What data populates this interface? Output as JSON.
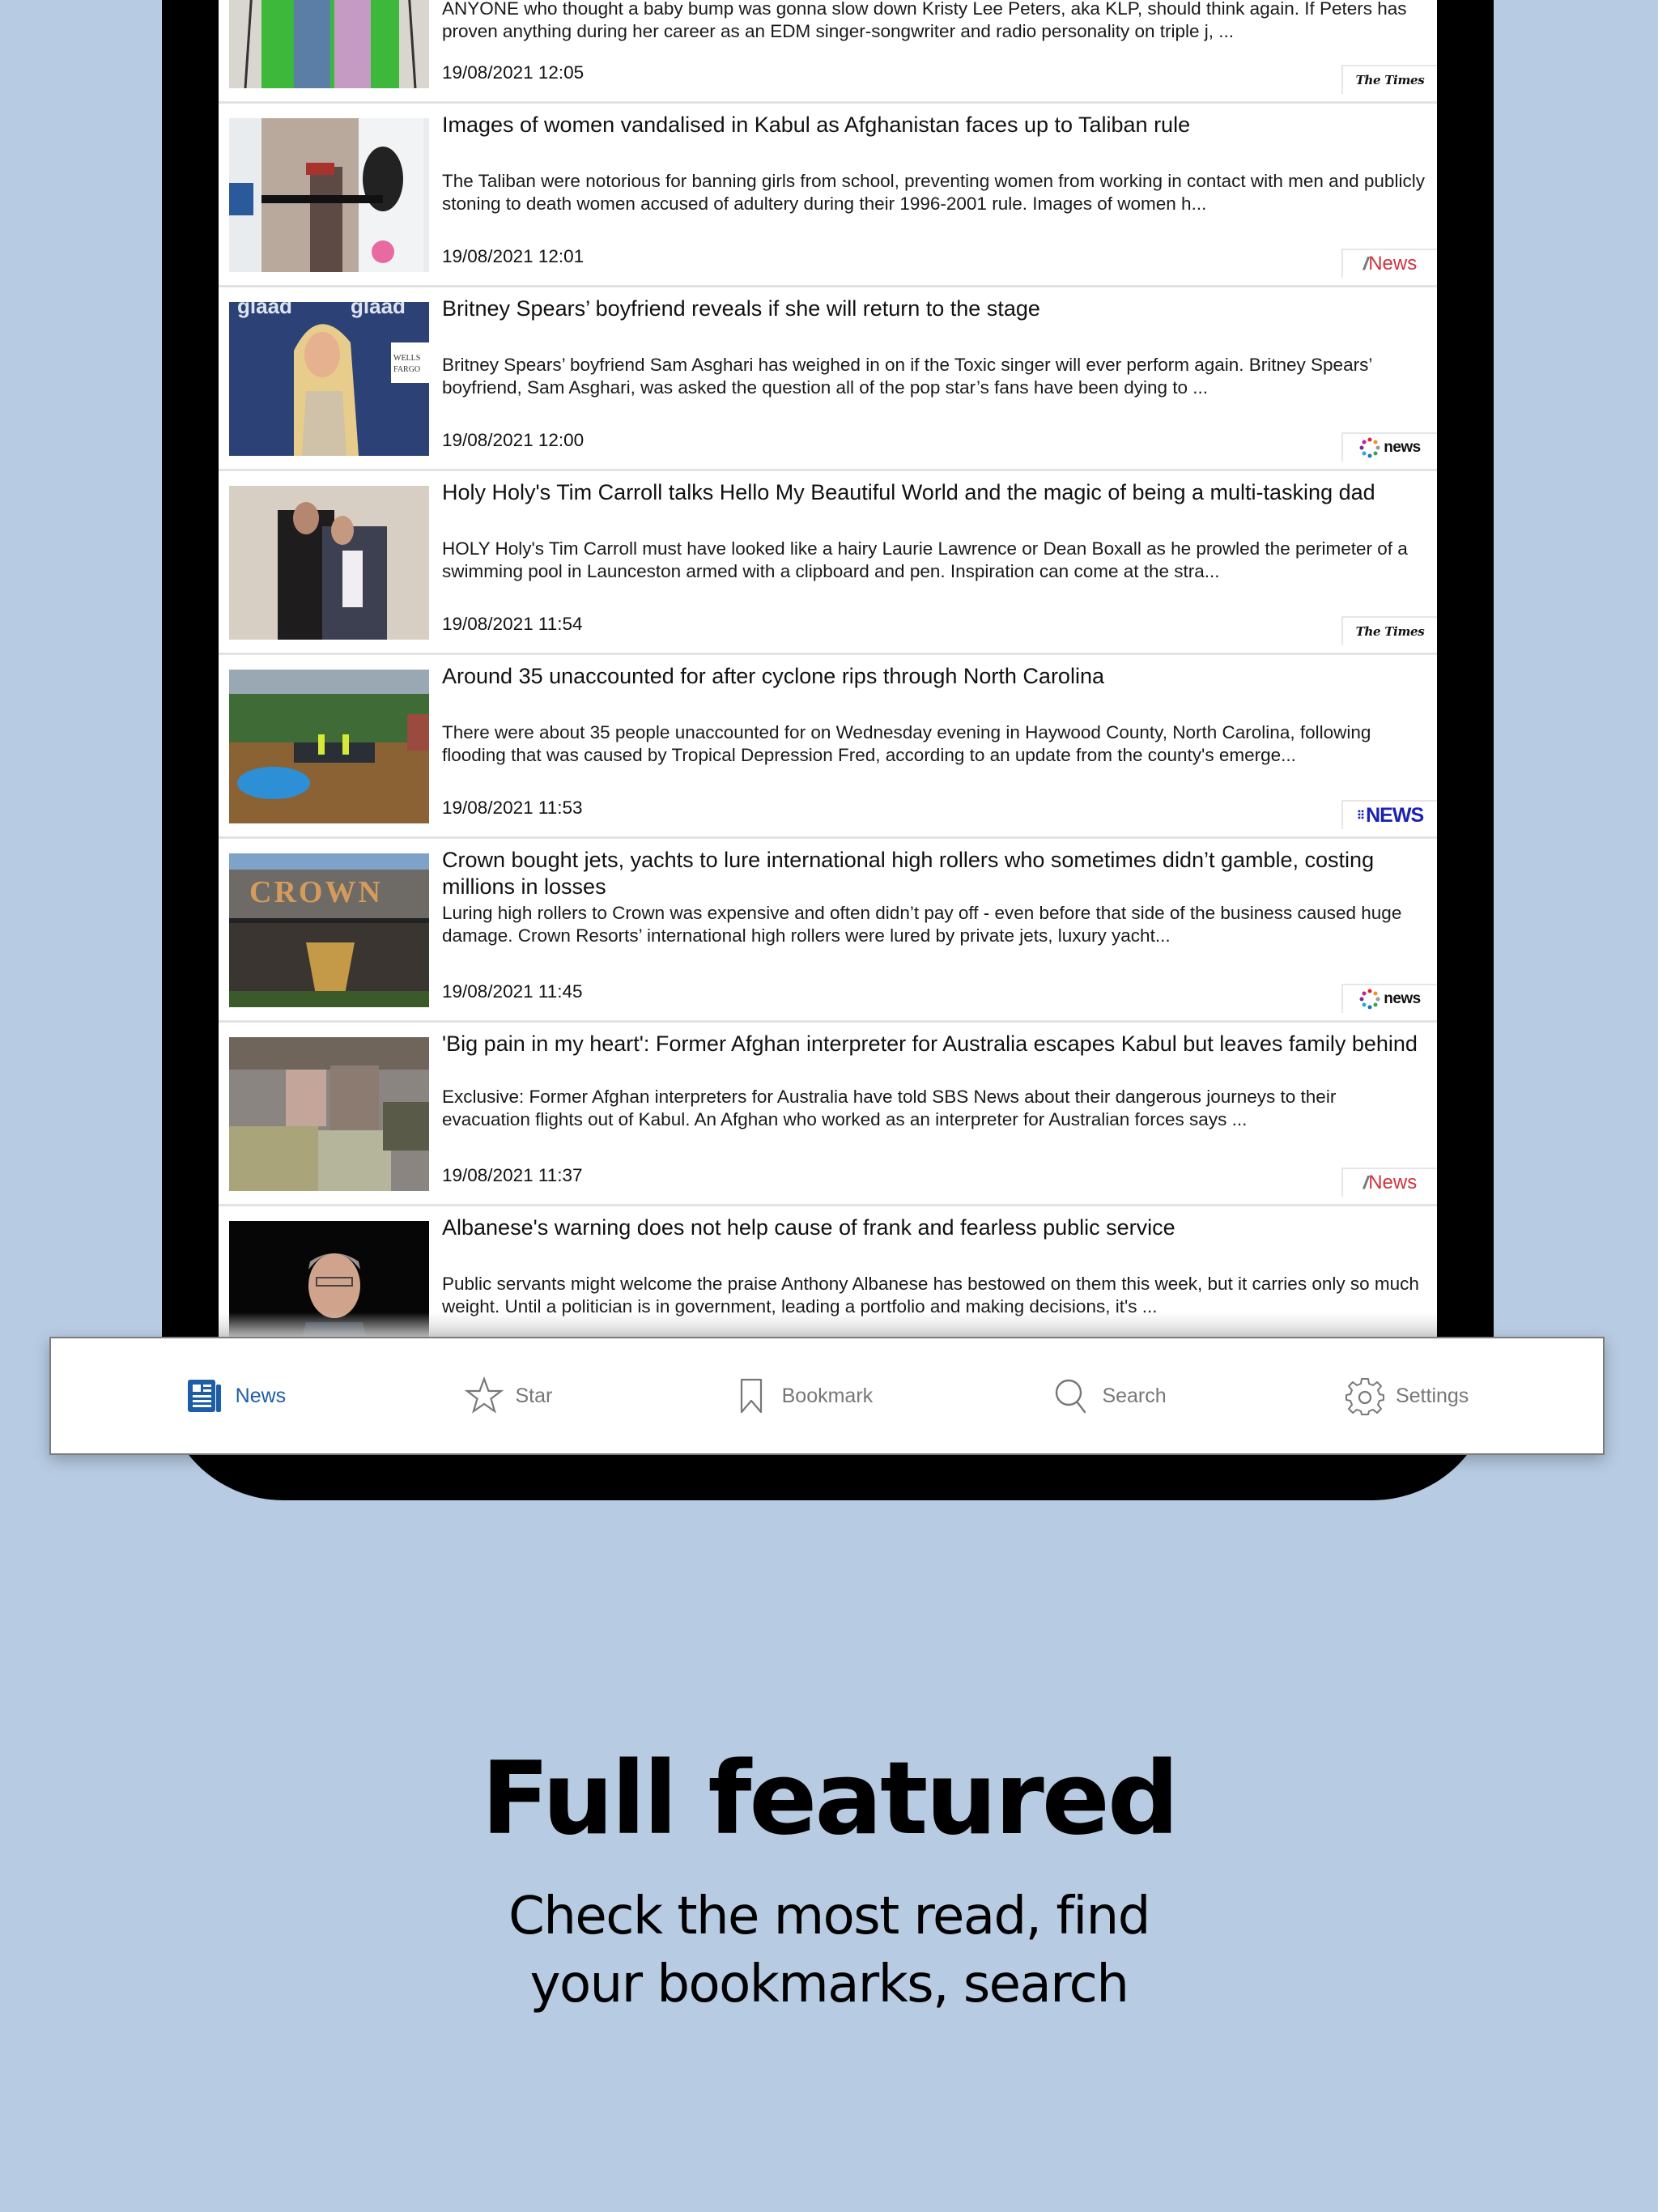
{
  "feed": {
    "articles": [
      {
        "title": "",
        "summary": "ANYONE who thought a baby bump was gonna slow down Kristy Lee Peters, aka KLP, should think again. If Peters has proven anything during her career as an EDM singer-songwriter and radio personality on triple j, ...",
        "timestamp": "19/08/2021 12:05",
        "source": "The Times",
        "thumbnail": "couple-green-screen-photo"
      },
      {
        "title": "Images of women vandalised in Kabul as Afghanistan faces up to Taliban rule",
        "summary": "The Taliban were notorious for banning girls from school, preventing women from working in contact with men and publicly stoning to death women accused of adultery during their 1996-2001 rule. Images of women h...",
        "timestamp": "19/08/2021 12:01",
        "source": "SBS News",
        "thumbnail": "kabul-vandalised-images-photo"
      },
      {
        "title": "Britney Spears’ boyfriend reveals if she will return to the stage",
        "summary": "Britney Spears’ boyfriend Sam Asghari has weighed in on if the Toxic singer will ever perform again. Britney Spears’ boyfriend, Sam Asghari, was asked the question all of the pop star’s fans have been dying to ...",
        "timestamp": "19/08/2021 12:00",
        "source": "7news",
        "thumbnail": "britney-red-carpet-photo"
      },
      {
        "title": "Holy Holy's Tim Carroll talks Hello My Beautiful World and the magic of being a multi-tasking dad",
        "summary": "HOLY Holy's Tim Carroll must have looked like a hairy Laurie Lawrence or Dean Boxall as he prowled the perimeter of a swimming pool in Launceston armed with a clipboard and pen. Inspiration can come at the stra...",
        "timestamp": "19/08/2021 11:54",
        "source": "The Times",
        "thumbnail": "holy-holy-band-photo"
      },
      {
        "title": "Around 35 unaccounted for after cyclone rips through North Carolina",
        "summary": "There were about 35 people unaccounted for on Wednesday evening in Haywood County, North Carolina, following flooding that was caused by Tropical Depression Fred, according to an update from the county's emerge...",
        "timestamp": "19/08/2021 11:53",
        "source": "9NEWS",
        "thumbnail": "flood-rescue-photo"
      },
      {
        "title": "Crown bought jets, yachts to lure international high rollers who sometimes didn’t gamble, costing millions in losses",
        "summary": "Luring high rollers to Crown was expensive and often didn’t pay off - even before that side of the business caused huge damage. Crown Resorts’ international high rollers were lured by private jets, luxury yacht...",
        "timestamp": "19/08/2021 11:45",
        "source": "7news",
        "thumbnail": "crown-casino-photo"
      },
      {
        "title": "'Big pain in my heart': Former Afghan interpreter for Australia escapes Kabul but leaves family behind",
        "summary": "Exclusive: Former Afghan interpreters for Australia have told SBS News about their dangerous journeys to their evacuation flights out of Kabul. An Afghan who worked as an interpreter for Australian forces says ...",
        "timestamp": "19/08/2021 11:37",
        "source": "SBS News",
        "thumbnail": "interpreter-soldiers-photo"
      },
      {
        "title": "Albanese's warning does not help cause of frank and fearless public service",
        "summary": "Public servants might welcome the praise Anthony Albanese has bestowed on them this week, but it carries only so much weight. Until a politician is in government, leading a portfolio and making decisions, it's ...",
        "timestamp": "",
        "source": "",
        "thumbnail": "albanese-portrait-photo"
      }
    ]
  },
  "sources": {
    "times": "The Times",
    "sbs_wings": "////",
    "sbs": "News",
    "seven": "news",
    "nine_dots": "⠿",
    "nine": "NEWS"
  },
  "tabbar": {
    "active": "news",
    "tabs": [
      {
        "id": "news",
        "label": "News",
        "icon": "newspaper-icon"
      },
      {
        "id": "star",
        "label": "Star",
        "icon": "star-icon"
      },
      {
        "id": "bookmark",
        "label": "Bookmark",
        "icon": "bookmark-icon"
      },
      {
        "id": "search",
        "label": "Search",
        "icon": "search-icon"
      },
      {
        "id": "settings",
        "label": "Settings",
        "icon": "gear-icon"
      }
    ]
  },
  "colors": {
    "background": "#b7cbe3",
    "accent": "#1e5ea8",
    "inactive": "#777777",
    "sbs_red": "#d0343c",
    "nine_blue": "#1922b4"
  },
  "promo": {
    "headline": "Full featured",
    "subline_1": "Check the most read, find",
    "subline_2": "your bookmarks, search"
  }
}
